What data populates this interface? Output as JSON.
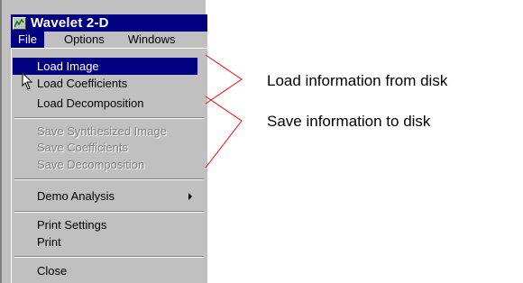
{
  "window": {
    "title": "Wavelet 2-D"
  },
  "menubar": {
    "items": [
      "File",
      "Options",
      "Windows"
    ]
  },
  "file_menu": {
    "load_items": [
      "Load Image",
      "Load Coefficients",
      "Load Decomposition"
    ],
    "save_items": [
      "Save Synthesized Image",
      "Save Coefficients",
      "Save Decomposition"
    ],
    "demo_item": "Demo Analysis",
    "print_items": [
      "Print Settings",
      "Print"
    ],
    "close_item": "Close"
  },
  "callouts": {
    "load": "Load information from disk",
    "save": "Save information to disk"
  },
  "colors": {
    "title_bar": "#000080",
    "menu_bg": "#c0c0c0",
    "highlight": "#000080",
    "callout_line": "#ff0000"
  }
}
